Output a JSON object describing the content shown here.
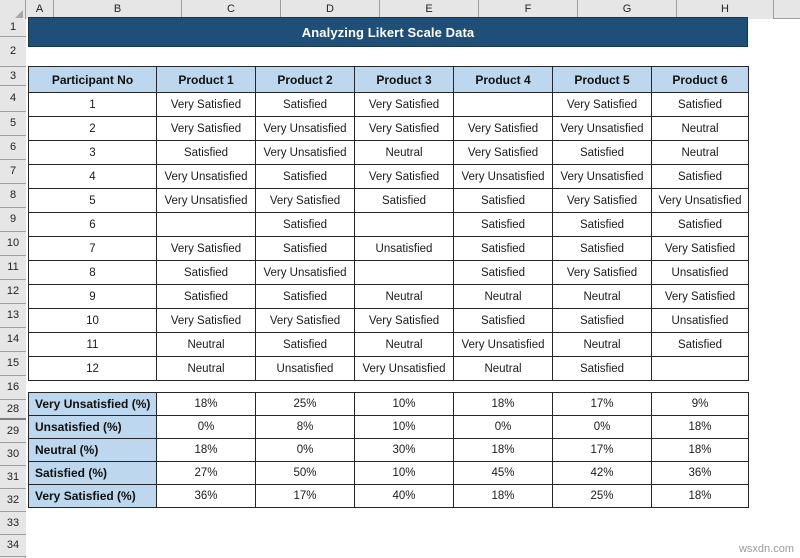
{
  "app": {
    "watermark": "wsxdn.com"
  },
  "grid": {
    "corner_icon": "select-all-triangle-icon",
    "column_headers": [
      "A",
      "B",
      "C",
      "D",
      "E",
      "F",
      "G",
      "H"
    ],
    "row_headers": [
      "1",
      "2",
      "3",
      "4",
      "5",
      "6",
      "7",
      "8",
      "9",
      "10",
      "11",
      "12",
      "13",
      "14",
      "15",
      "16",
      "28",
      "29",
      "30",
      "31",
      "32",
      "33",
      "34"
    ]
  },
  "title": {
    "text": "Analyzing Likert Scale Data",
    "background": "#1F4E79",
    "color": "#FFFFFF"
  },
  "colors": {
    "header_fill": "#BDD7EE",
    "title_fill": "#1F4E79",
    "grid_header": "#E6E6E6",
    "border": "#26262A"
  },
  "main_table": {
    "headers": [
      "Participant No",
      "Product 1",
      "Product 2",
      "Product 3",
      "Product 4",
      "Product 5",
      "Product 6"
    ],
    "rows": [
      [
        "1",
        "Very Satisfied",
        "Satisfied",
        "Very Satisfied",
        "",
        "Very Satisfied",
        "Satisfied"
      ],
      [
        "2",
        "Very Satisfied",
        "Very Unsatisfied",
        "Very Satisfied",
        "Very Satisfied",
        "Very Unsatisfied",
        "Neutral"
      ],
      [
        "3",
        "Satisfied",
        "Very Unsatisfied",
        "Neutral",
        "Very Satisfied",
        "Satisfied",
        "Neutral"
      ],
      [
        "4",
        "Very Unsatisfied",
        "Satisfied",
        "Very Satisfied",
        "Very Unsatisfied",
        "Very Unsatisfied",
        "Satisfied"
      ],
      [
        "5",
        "Very Unsatisfied",
        "Very Satisfied",
        "Satisfied",
        "Satisfied",
        "Very Satisfied",
        "Very Unsatisfied"
      ],
      [
        "6",
        "",
        "Satisfied",
        "",
        "Satisfied",
        "Satisfied",
        "Satisfied"
      ],
      [
        "7",
        "Very Satisfied",
        "Satisfied",
        "Unsatisfied",
        "Satisfied",
        "Satisfied",
        "Very Satisfied"
      ],
      [
        "8",
        "Satisfied",
        "Very Unsatisfied",
        "",
        "Satisfied",
        "Very Satisfied",
        "Unsatisfied"
      ],
      [
        "9",
        "Satisfied",
        "Satisfied",
        "Neutral",
        "Neutral",
        "Neutral",
        "Very Satisfied"
      ],
      [
        "10",
        "Very Satisfied",
        "Very Satisfied",
        "Very Satisfied",
        "Satisfied",
        "Satisfied",
        "Unsatisfied"
      ],
      [
        "11",
        "Neutral",
        "Satisfied",
        "Neutral",
        "Very Unsatisfied",
        "Neutral",
        "Satisfied"
      ],
      [
        "12",
        "Neutral",
        "Unsatisfied",
        "Very Unsatisfied",
        "Neutral",
        "Satisfied",
        ""
      ]
    ]
  },
  "summary_table": {
    "rows": [
      {
        "label": "Very Unsatisfied (%)",
        "values": [
          "18%",
          "25%",
          "10%",
          "18%",
          "17%",
          "9%"
        ]
      },
      {
        "label": "Unsatisfied (%)",
        "values": [
          "0%",
          "8%",
          "10%",
          "0%",
          "0%",
          "18%"
        ]
      },
      {
        "label": "Neutral (%)",
        "values": [
          "18%",
          "0%",
          "30%",
          "18%",
          "17%",
          "18%"
        ]
      },
      {
        "label": "Satisfied (%)",
        "values": [
          "27%",
          "50%",
          "10%",
          "45%",
          "42%",
          "36%"
        ]
      },
      {
        "label": "Very Satisfied (%)",
        "values": [
          "36%",
          "17%",
          "40%",
          "18%",
          "25%",
          "18%"
        ]
      }
    ]
  }
}
